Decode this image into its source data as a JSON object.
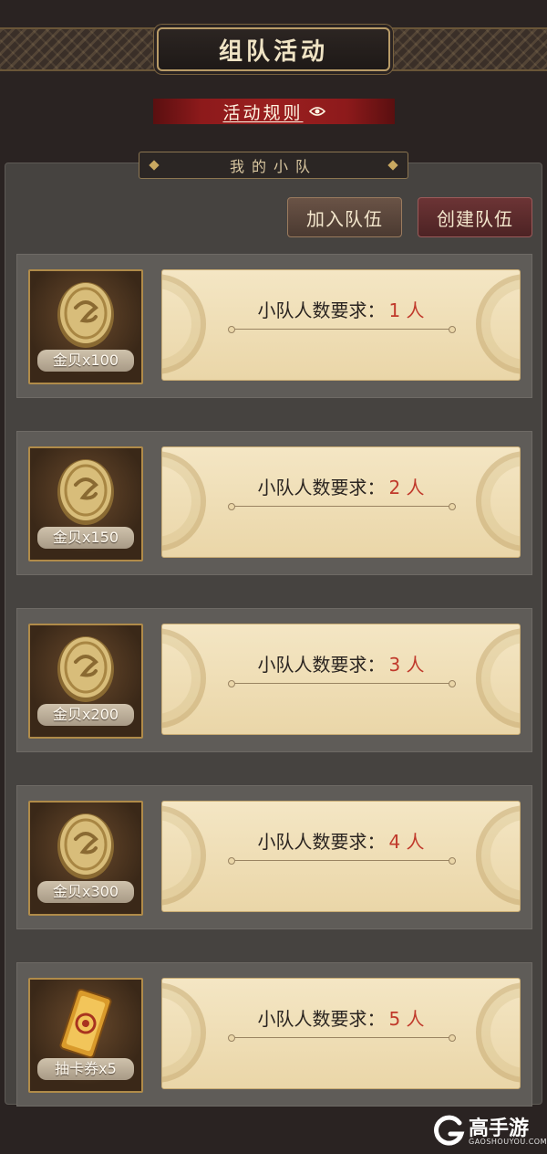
{
  "header": {
    "title": "组队活动"
  },
  "rules": {
    "label": "活动规则"
  },
  "section": {
    "title": "我的小队"
  },
  "buttons": {
    "join": "加入队伍",
    "create": "创建队伍"
  },
  "tasks": [
    {
      "reward": "金贝x100",
      "reward_icon": "gold-coin-icon",
      "requirement_label": "小队人数要求：",
      "requirement_value": "1 人"
    },
    {
      "reward": "金贝x150",
      "reward_icon": "gold-coin-icon",
      "requirement_label": "小队人数要求：",
      "requirement_value": "2 人"
    },
    {
      "reward": "金贝x200",
      "reward_icon": "gold-coin-icon",
      "requirement_label": "小队人数要求：",
      "requirement_value": "3 人"
    },
    {
      "reward": "金贝x300",
      "reward_icon": "gold-coin-icon",
      "requirement_label": "小队人数要求：",
      "requirement_value": "4 人"
    },
    {
      "reward": "抽卡券x5",
      "reward_icon": "draw-ticket-icon",
      "requirement_label": "小队人数要求：",
      "requirement_value": "5 人"
    }
  ],
  "watermark": {
    "name": "高手游",
    "domain": "GAOSHOUYOU.COM"
  },
  "colors": {
    "accent_red": "#c0392b",
    "gold": "#c9a961",
    "panel": "#464340"
  }
}
